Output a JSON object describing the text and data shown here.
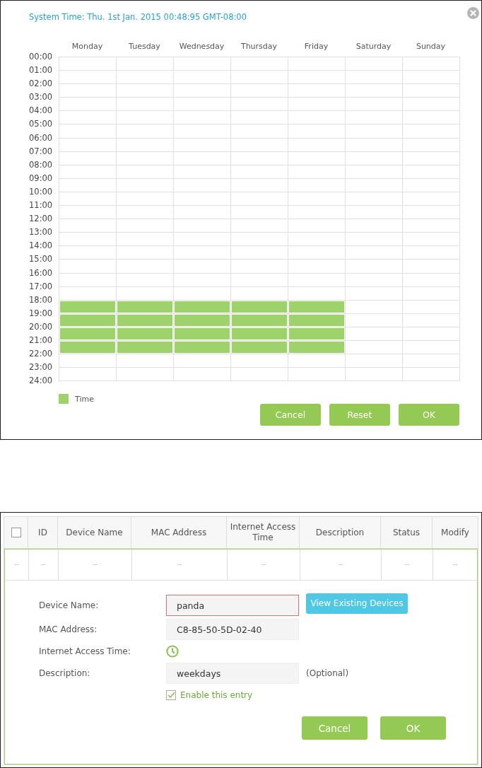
{
  "schedule_dialog": {
    "system_time": "System Time: Thu. 1st Jan. 2015 00:48:95 GMT-08:00",
    "days": [
      {
        "label": "Monday",
        "slots": [
          false,
          false,
          false,
          false,
          false,
          false,
          false,
          false,
          false,
          false,
          false,
          false,
          false,
          false,
          false,
          false,
          false,
          false,
          true,
          true,
          true,
          true,
          false,
          false
        ]
      },
      {
        "label": "Tuesday",
        "slots": [
          false,
          false,
          false,
          false,
          false,
          false,
          false,
          false,
          false,
          false,
          false,
          false,
          false,
          false,
          false,
          false,
          false,
          false,
          true,
          true,
          true,
          true,
          false,
          false
        ]
      },
      {
        "label": "Wednesday",
        "slots": [
          false,
          false,
          false,
          false,
          false,
          false,
          false,
          false,
          false,
          false,
          false,
          false,
          false,
          false,
          false,
          false,
          false,
          false,
          true,
          true,
          true,
          true,
          false,
          false
        ]
      },
      {
        "label": "Thursday",
        "slots": [
          false,
          false,
          false,
          false,
          false,
          false,
          false,
          false,
          false,
          false,
          false,
          false,
          false,
          false,
          false,
          false,
          false,
          false,
          true,
          true,
          true,
          true,
          false,
          false
        ]
      },
      {
        "label": "Friday",
        "slots": [
          false,
          false,
          false,
          false,
          false,
          false,
          false,
          false,
          false,
          false,
          false,
          false,
          false,
          false,
          false,
          false,
          false,
          false,
          true,
          true,
          true,
          true,
          false,
          false
        ]
      },
      {
        "label": "Saturday",
        "slots": [
          false,
          false,
          false,
          false,
          false,
          false,
          false,
          false,
          false,
          false,
          false,
          false,
          false,
          false,
          false,
          false,
          false,
          false,
          false,
          false,
          false,
          false,
          false,
          false
        ]
      },
      {
        "label": "Sunday",
        "slots": [
          false,
          false,
          false,
          false,
          false,
          false,
          false,
          false,
          false,
          false,
          false,
          false,
          false,
          false,
          false,
          false,
          false,
          false,
          false,
          false,
          false,
          false,
          false,
          false
        ]
      }
    ],
    "hours": [
      "00:00",
      "01:00",
      "02:00",
      "03:00",
      "04:00",
      "05:00",
      "06:00",
      "07:00",
      "08:00",
      "09:00",
      "10:00",
      "11:00",
      "12:00",
      "13:00",
      "14:00",
      "15:00",
      "16:00",
      "17:00",
      "18:00",
      "19:00",
      "20:00",
      "21:00",
      "22:00",
      "23:00",
      "24:00"
    ],
    "legend": "Time",
    "buttons": [
      "Cancel",
      "Reset",
      "OK"
    ]
  },
  "device_panel": {
    "table": {
      "columns": [
        {
          "kind": "checkbox",
          "checked": false
        },
        {
          "kind": "text",
          "label": "ID"
        },
        {
          "kind": "text",
          "label": "Device Name"
        },
        {
          "kind": "text",
          "label": "MAC Address"
        },
        {
          "kind": "text",
          "label": "Internet Access Time"
        },
        {
          "kind": "text",
          "label": "Description"
        },
        {
          "kind": "text",
          "label": "Status"
        },
        {
          "kind": "text",
          "label": "Modify"
        }
      ],
      "rows": [
        [
          "--",
          "--",
          "--",
          "--",
          "--",
          "--",
          "--",
          "--"
        ]
      ]
    },
    "form": {
      "fields": [
        {
          "kind": "input",
          "label": "Device Name:",
          "value": "panda",
          "invalid": true,
          "action": "View Existing Devices"
        },
        {
          "kind": "input",
          "label": "MAC Address:",
          "value": "C8-85-50-5D-02-40",
          "invalid": false
        },
        {
          "kind": "schedule",
          "label": "Internet Access Time:"
        },
        {
          "kind": "input",
          "label": "Description:",
          "value": "weekdays",
          "invalid": false,
          "note": "(Optional)"
        }
      ],
      "enable": {
        "label": "Enable this entry",
        "checked": true
      },
      "buttons": [
        "Cancel",
        "OK"
      ]
    }
  }
}
